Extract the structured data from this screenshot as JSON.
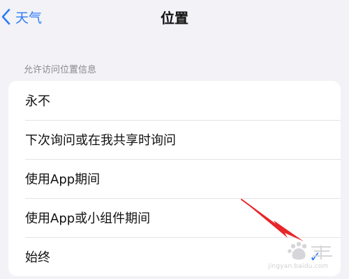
{
  "nav": {
    "back_label": "天气",
    "title": "位置"
  },
  "section": {
    "header": "允许访问位置信息"
  },
  "options": [
    {
      "label": "永不"
    },
    {
      "label": "下次询问或在我共享时询问"
    },
    {
      "label": "使用App期间"
    },
    {
      "label": "使用App或小组件期间"
    },
    {
      "label": "始终"
    }
  ],
  "watermark": {
    "url": "jingyan.baidu.com"
  },
  "colors": {
    "accent": "#2f7cf6",
    "background": "#f2f2f7",
    "annotation_arrow": "#e8262a"
  }
}
